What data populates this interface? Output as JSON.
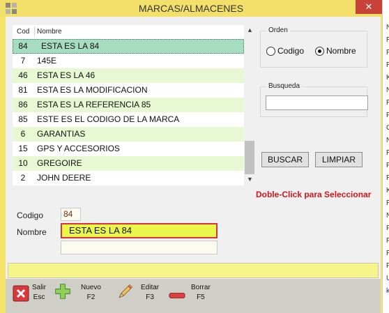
{
  "window": {
    "title": "MARCAS/ALMACENES",
    "close_label": "✕"
  },
  "list": {
    "columns": {
      "cod": "Cod",
      "nombre": "Nombre"
    },
    "rows": [
      {
        "cod": "84",
        "nombre": "ESTA ES LA 84"
      },
      {
        "cod": "7",
        "nombre": "145E"
      },
      {
        "cod": "46",
        "nombre": "ESTA ES LA 46"
      },
      {
        "cod": "81",
        "nombre": "ESTA ES LA MODIFICACION"
      },
      {
        "cod": "86",
        "nombre": "ESTA ES LA REFERENCIA 85"
      },
      {
        "cod": "85",
        "nombre": "ESTE ES EL CODIGO DE LA MARCA"
      },
      {
        "cod": "6",
        "nombre": "GARANTIAS"
      },
      {
        "cod": "15",
        "nombre": "GPS Y ACCESORIOS"
      },
      {
        "cod": "10",
        "nombre": "GREGOIRE"
      },
      {
        "cod": "2",
        "nombre": "JOHN DEERE"
      }
    ],
    "selected_row_color": "#a6dcc0",
    "alt_row_color": "#e8f8d2"
  },
  "orden": {
    "title": "Orden",
    "option_codigo": "Codigo",
    "option_nombre": "Nombre",
    "selected": "Nombre"
  },
  "busqueda": {
    "title": "Busqueda",
    "value": ""
  },
  "buttons": {
    "buscar": "BUSCAR",
    "limpiar": "LIMPIAR"
  },
  "hint": "Doble-Click para Seleccionar",
  "form": {
    "codigo_label": "Codigo",
    "codigo_value": "84",
    "nombre_label": "Nombre",
    "nombre_value": "ESTA ES LA 84",
    "extra_value": ""
  },
  "status": {
    "text": ""
  },
  "toolbar": {
    "salir": "Salir\nEsc",
    "nuevo": "Nuevo\nF2",
    "editar": "Editar\nF3",
    "borrar": "Borrar\nF5"
  },
  "colors": {
    "title_bar": "#f2e06a",
    "hint_red": "#d3151b",
    "field_yellow": "#eaf74a"
  },
  "right_strip_chars": [
    "N",
    "R",
    "F",
    "R",
    "K",
    "N",
    "R",
    "F",
    "C",
    "N",
    "R",
    "F",
    "R",
    "K",
    "R",
    "N",
    "F",
    "F",
    "R",
    "F",
    "U",
    "k"
  ]
}
